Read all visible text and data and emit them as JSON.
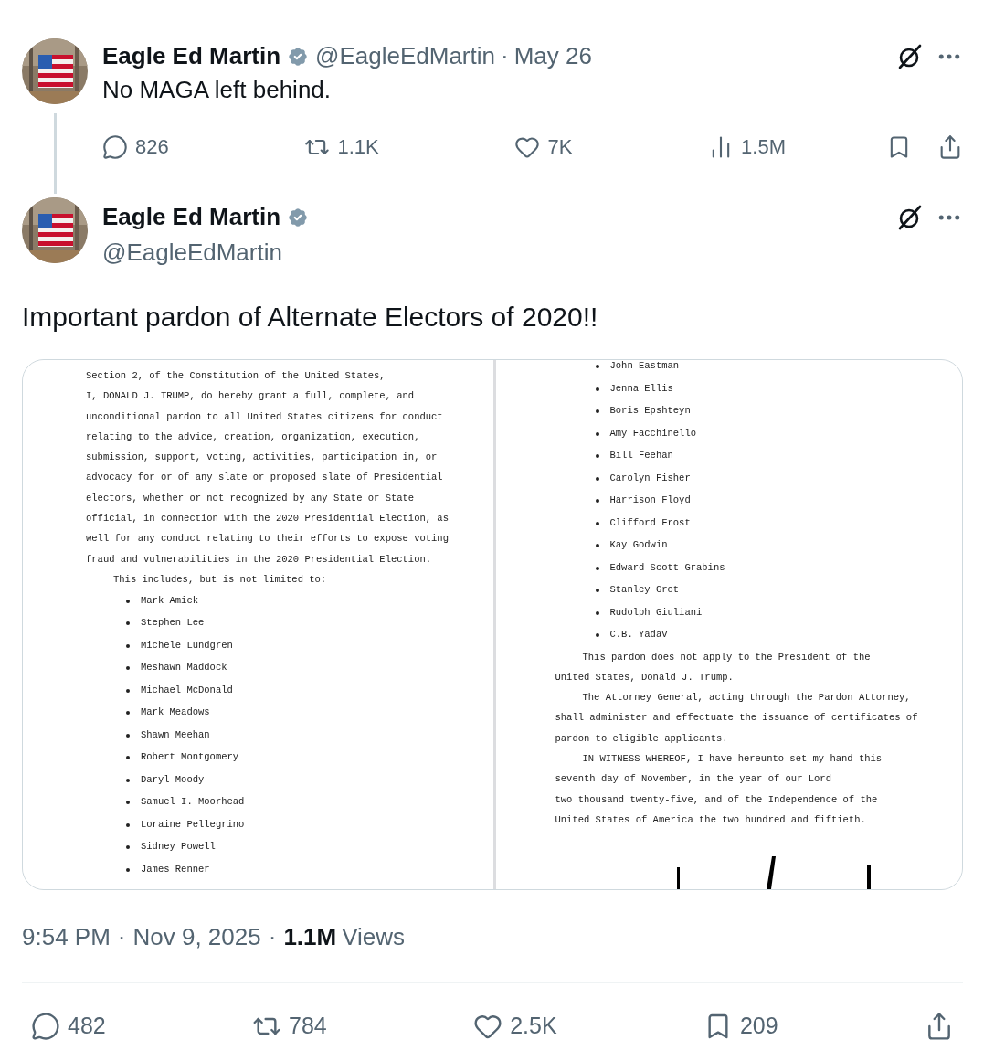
{
  "parent_tweet": {
    "name": "Eagle Ed Martin",
    "verified": true,
    "handle": "@EagleEdMartin",
    "separator": "·",
    "date": "May 26",
    "text": "No MAGA left behind.",
    "actions": [
      {
        "kind": "reply",
        "count": "826"
      },
      {
        "kind": "repost",
        "count": "1.1K"
      },
      {
        "kind": "like",
        "count": "7K"
      },
      {
        "kind": "views",
        "count": "1.5M"
      }
    ]
  },
  "tweet": {
    "name": "Eagle Ed Martin",
    "verified": true,
    "handle": "@EagleEdMartin",
    "text": "Important pardon of Alternate Electors of 2020!!",
    "media": {
      "pages": [
        {
          "lines": [
            {
              "kind": "line",
              "text": "Section 2, of the Constitution of the United States,"
            },
            {
              "kind": "line",
              "text": "I, DONALD J. TRUMP, do hereby grant a full, complete, and"
            },
            {
              "kind": "line",
              "text": "unconditional pardon to all United States citizens for conduct"
            },
            {
              "kind": "line",
              "text": "relating to the advice, creation, organization, execution,"
            },
            {
              "kind": "line",
              "text": "submission, support, voting, activities, participation in, or"
            },
            {
              "kind": "line",
              "text": "advocacy for or of any slate or proposed slate of Presidential"
            },
            {
              "kind": "line",
              "text": "electors, whether or not recognized by any State or State"
            },
            {
              "kind": "line",
              "text": "official, in connection with the 2020 Presidential Election, as"
            },
            {
              "kind": "line",
              "text": "well for any conduct relating to their efforts to expose voting"
            },
            {
              "kind": "line",
              "text": "fraud and vulnerabilities in the 2020 Presidential Election."
            },
            {
              "kind": "indent",
              "text": "This includes, but is not limited to:"
            },
            {
              "kind": "bullet",
              "text": "Mark Amick"
            },
            {
              "kind": "bullet",
              "text": "Stephen Lee"
            },
            {
              "kind": "bullet",
              "text": "Michele Lundgren"
            },
            {
              "kind": "bullet",
              "text": "Meshawn Maddock"
            },
            {
              "kind": "bullet",
              "text": "Michael McDonald"
            },
            {
              "kind": "bullet",
              "text": "Mark Meadows"
            },
            {
              "kind": "bullet",
              "text": "Shawn Meehan"
            },
            {
              "kind": "bullet",
              "text": "Robert Montgomery"
            },
            {
              "kind": "bullet",
              "text": "Daryl Moody"
            },
            {
              "kind": "bullet",
              "text": "Samuel I. Moorhead"
            },
            {
              "kind": "bullet",
              "text": "Loraine Pellegrino"
            },
            {
              "kind": "bullet",
              "text": "Sidney Powell"
            },
            {
              "kind": "bullet",
              "text": "James Renner"
            }
          ]
        },
        {
          "lines": [
            {
              "kind": "bullet",
              "text": "John Eastman"
            },
            {
              "kind": "bullet",
              "text": "Jenna Ellis"
            },
            {
              "kind": "bullet",
              "text": "Boris Epshteyn"
            },
            {
              "kind": "bullet",
              "text": "Amy Facchinello"
            },
            {
              "kind": "bullet",
              "text": "Bill Feehan"
            },
            {
              "kind": "bullet",
              "text": "Carolyn Fisher"
            },
            {
              "kind": "bullet",
              "text": "Harrison Floyd"
            },
            {
              "kind": "bullet",
              "text": "Clifford Frost"
            },
            {
              "kind": "bullet",
              "text": "Kay Godwin"
            },
            {
              "kind": "bullet",
              "text": "Edward Scott Grabins"
            },
            {
              "kind": "bullet",
              "text": "Stanley Grot"
            },
            {
              "kind": "bullet",
              "text": "Rudolph Giuliani"
            },
            {
              "kind": "bullet",
              "text": "C.B. Yadav"
            },
            {
              "kind": "indent",
              "text": "This pardon does not apply to the President of the"
            },
            {
              "kind": "line",
              "text": "United States, Donald J. Trump."
            },
            {
              "kind": "indent",
              "text": "The Attorney General, acting through the Pardon Attorney,"
            },
            {
              "kind": "line",
              "text": "shall administer and effectuate the issuance of certificates of"
            },
            {
              "kind": "line",
              "text": "pardon to eligible applicants."
            },
            {
              "kind": "indent",
              "text": "IN WITNESS WHEREOF, I have hereunto set my hand this"
            },
            {
              "kind": "line",
              "text": "seventh day of November, in the year of our Lord"
            },
            {
              "kind": "line",
              "text": "two thousand twenty-five, and of the Independence of the"
            },
            {
              "kind": "line",
              "text": "United States of America the two hundred and fiftieth."
            },
            {
              "kind": "signature"
            }
          ]
        }
      ]
    },
    "time": "9:54 PM",
    "separator": "·",
    "date": "Nov 9, 2025",
    "separator_2": "·",
    "views_count": "1.1M",
    "views_label": "Views",
    "actions": [
      {
        "kind": "reply",
        "count": "482"
      },
      {
        "kind": "repost",
        "count": "784"
      },
      {
        "kind": "like",
        "count": "2.5K"
      },
      {
        "kind": "bookmark",
        "count": "209"
      },
      {
        "kind": "share"
      }
    ]
  }
}
